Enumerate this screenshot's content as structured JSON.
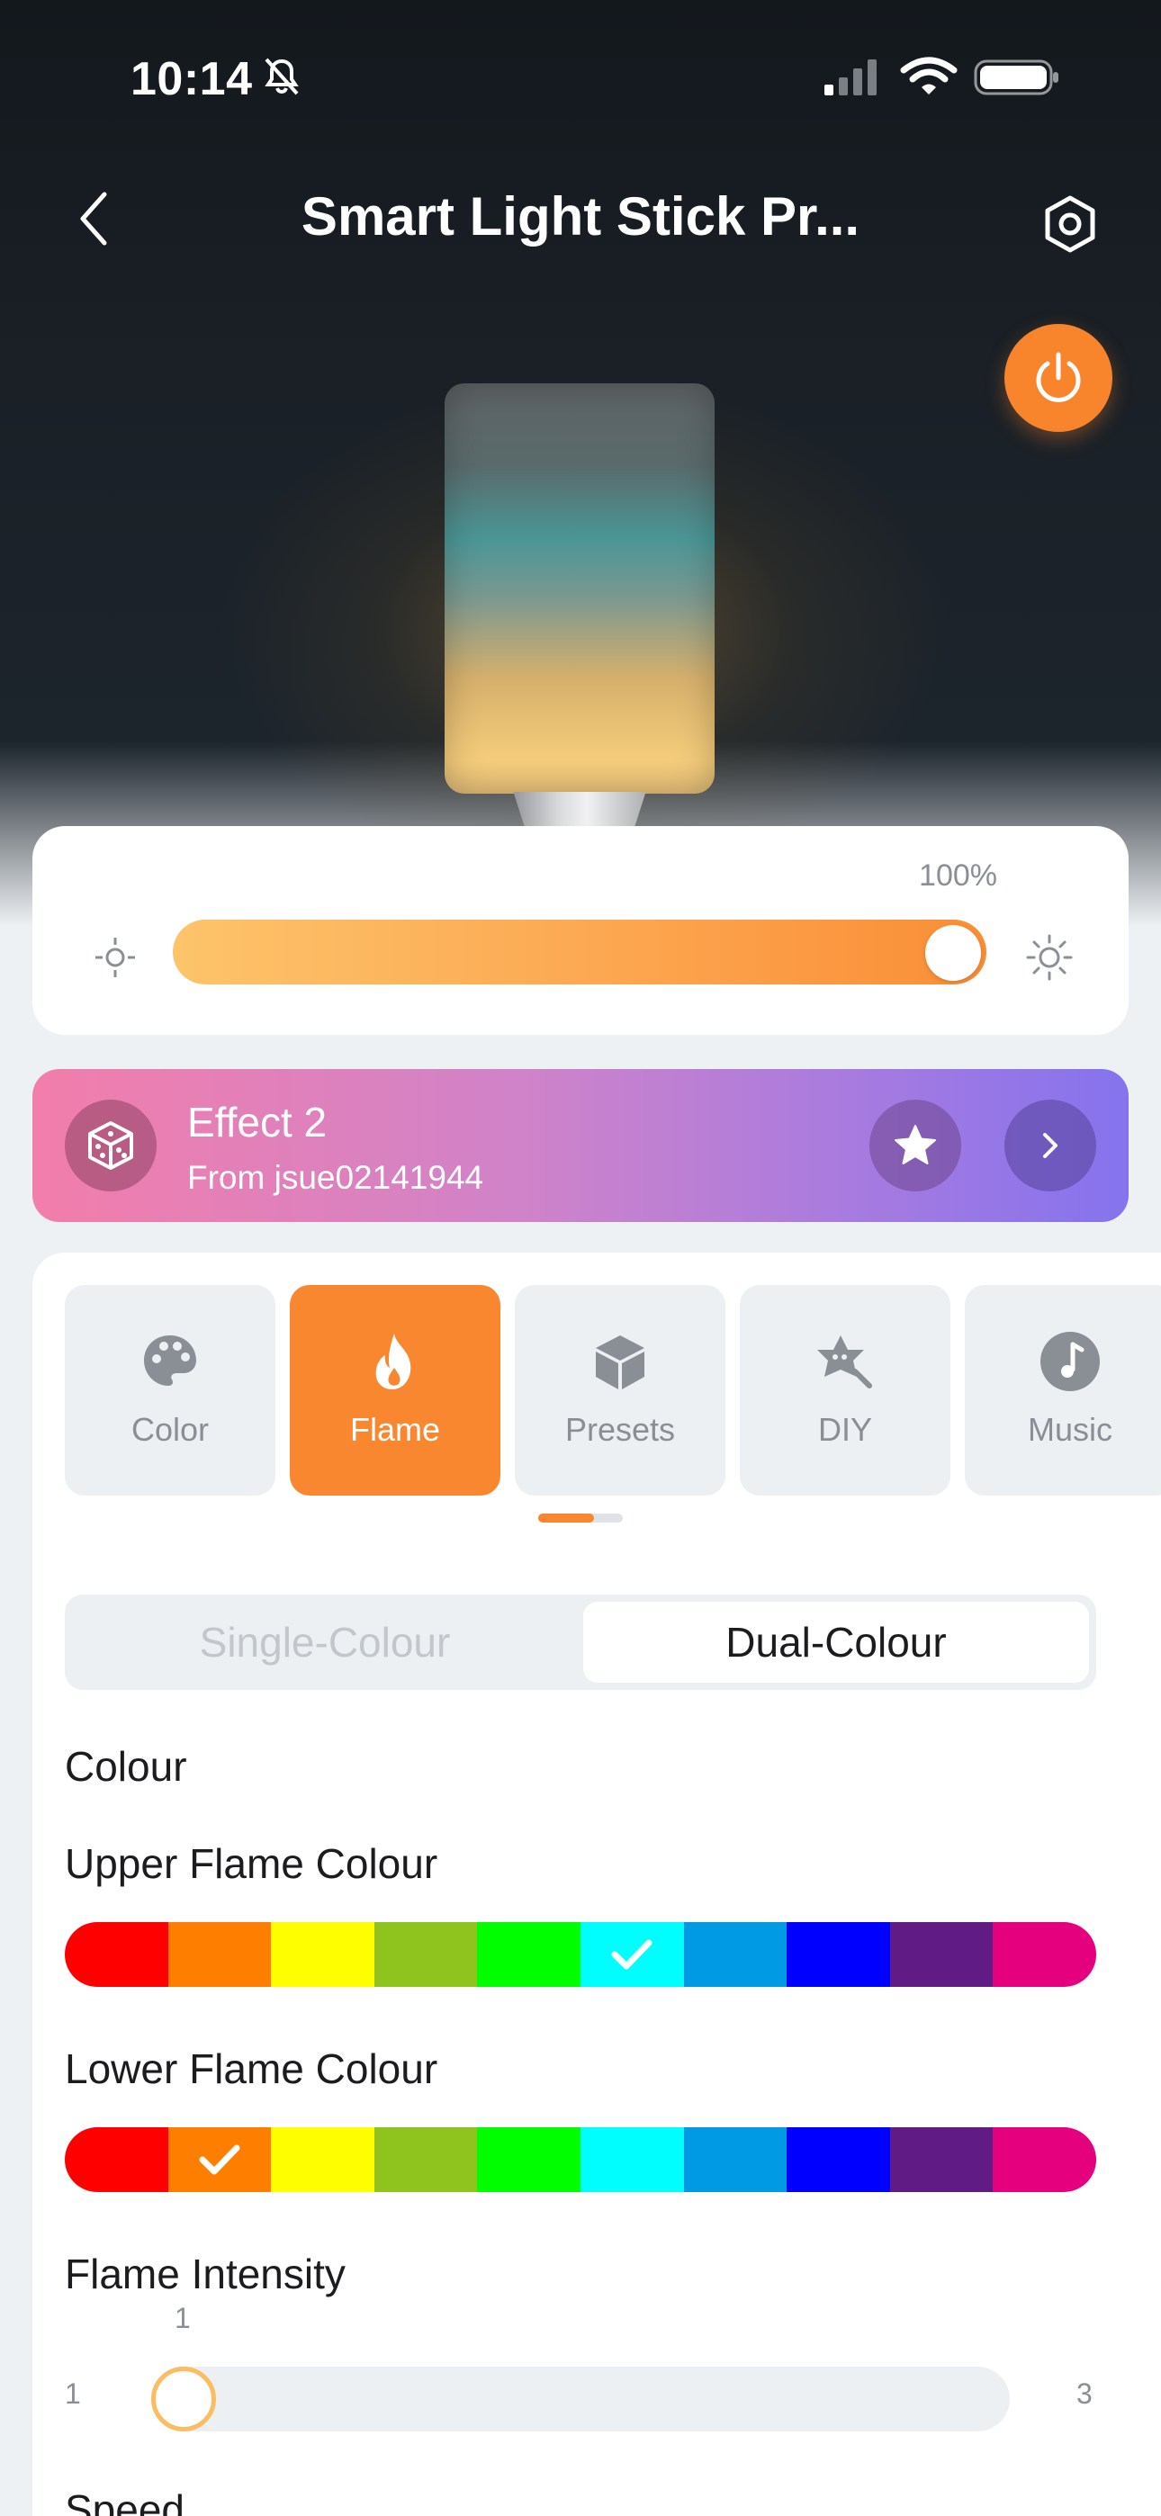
{
  "status_bar": {
    "time": "10:14"
  },
  "header": {
    "title": "Smart Light Stick Pr..."
  },
  "brightness": {
    "value_label": "100%",
    "level_percent": 100
  },
  "effect": {
    "title": "Effect 2",
    "subtitle": "From jsue02141944"
  },
  "tabs": [
    {
      "label": "Color",
      "icon": "palette-icon"
    },
    {
      "label": "Flame",
      "icon": "flame-icon"
    },
    {
      "label": "Presets",
      "icon": "cube-icon"
    },
    {
      "label": "DIY",
      "icon": "diy-star-icon"
    },
    {
      "label": "Music",
      "icon": "music-note-icon"
    }
  ],
  "active_tab": "Flame",
  "mode_toggle": {
    "options": [
      "Single-Colour",
      "Dual-Colour"
    ],
    "selected": "Dual-Colour"
  },
  "colour_section": {
    "label": "Colour"
  },
  "upper_flame": {
    "label": "Upper Flame Colour",
    "selected_index": 5
  },
  "lower_flame": {
    "label": "Lower Flame Colour",
    "selected_index": 1
  },
  "palette_colors": [
    "#fe0000",
    "#fe7f00",
    "#fefe00",
    "#8fc41f",
    "#00fe00",
    "#00fefe",
    "#009ae4",
    "#0000fe",
    "#611b85",
    "#e5007d"
  ],
  "intensity": {
    "label": "Flame Intensity",
    "value": "1",
    "min": "1",
    "max": "3"
  },
  "speed": {
    "label": "Speed"
  },
  "colors": {
    "accent": "#f8872f",
    "power": "#f8852c"
  }
}
